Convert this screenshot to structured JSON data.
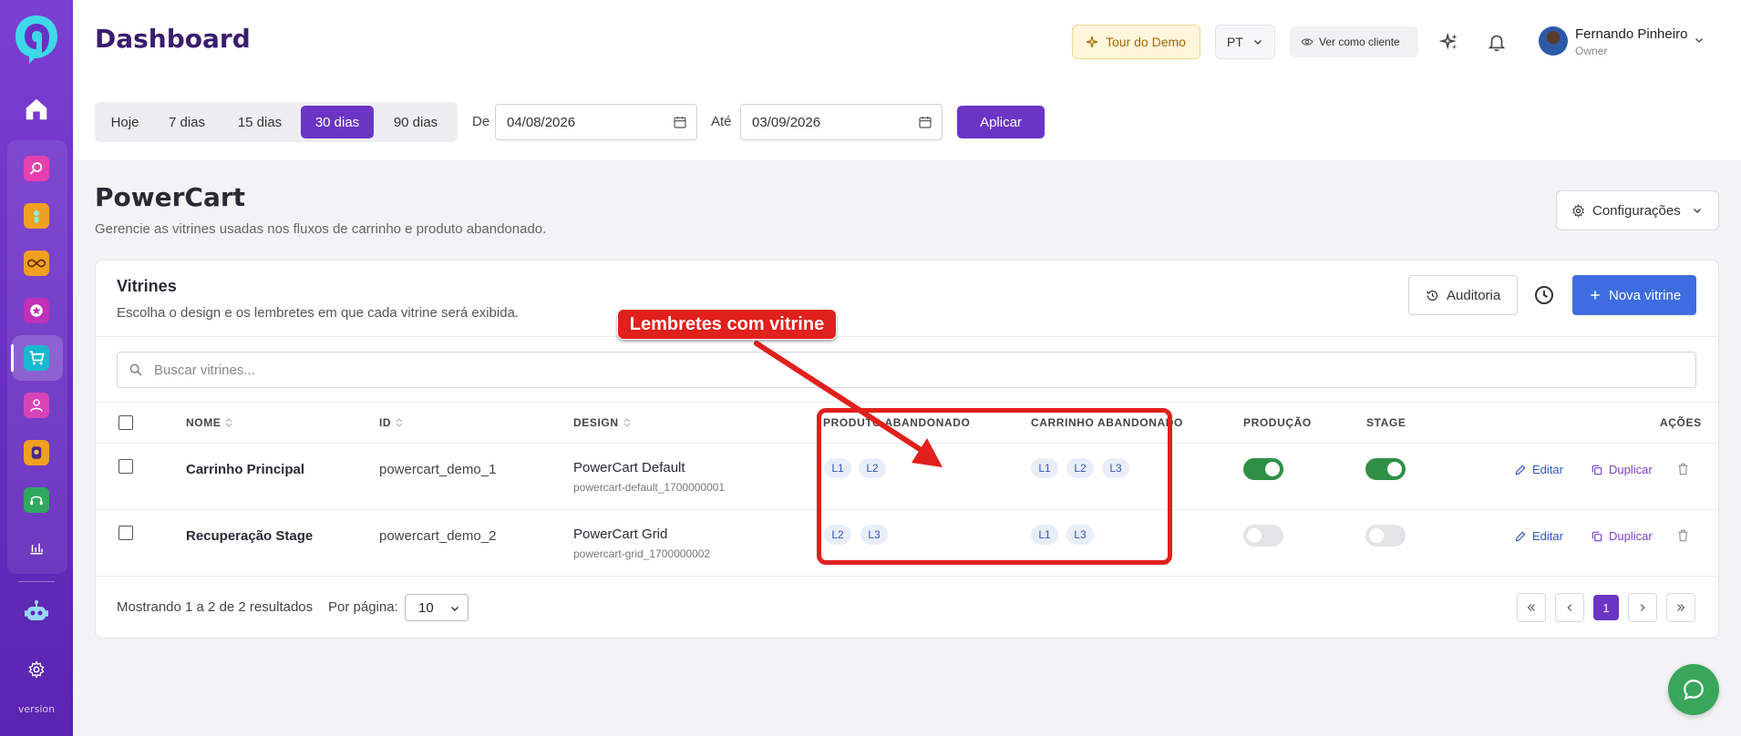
{
  "sidebar": {
    "version_label": "version",
    "items": [
      {
        "icon": "home-icon",
        "color": "#ffffff"
      },
      {
        "icon": "search-app-icon",
        "color": "#e63fb0"
      },
      {
        "icon": "user-app-icon",
        "color": "#f0a020"
      },
      {
        "icon": "infinity-app-icon",
        "color": "#f0a020"
      },
      {
        "icon": "star-app-icon",
        "color": "#c030b8"
      },
      {
        "icon": "cart-app-icon",
        "color": "#18b8d0",
        "active": true
      },
      {
        "icon": "person-app-icon",
        "color": "#d844b8"
      },
      {
        "icon": "badge-app-icon",
        "color": "#f0a020"
      },
      {
        "icon": "support-app-icon",
        "color": "#2fa860"
      },
      {
        "icon": "chart-icon",
        "color": "#ffffff"
      },
      {
        "icon": "robot-icon",
        "color": "#7ad0ff"
      },
      {
        "icon": "gear-icon",
        "color": "#ffffff"
      }
    ]
  },
  "header": {
    "title": "Dashboard",
    "tour_label": "Tour do Demo",
    "lang_label": "PT",
    "view_as_client_label": "Ver como cliente",
    "user_name": "Fernando Pinheiro",
    "user_role": "Owner"
  },
  "filters": {
    "ranges": [
      "Hoje",
      "7 dias",
      "15 dias",
      "30 dias",
      "90 dias"
    ],
    "active_range": "30 dias",
    "from_label": "De",
    "from_value": "04/08/2026",
    "to_label": "Até",
    "to_value": "03/09/2026",
    "apply_label": "Aplicar"
  },
  "section": {
    "title": "PowerCart",
    "subtitle": "Gerencie as vitrines usadas nos fluxos de carrinho e produto abandonado.",
    "config_label": "Configurações"
  },
  "card": {
    "title": "Vitrines",
    "subtitle": "Escolha o design e os lembretes em que cada vitrine será exibida.",
    "audit_label": "Auditoria",
    "new_label": "Nova vitrine",
    "search_placeholder": "Buscar vitrines...",
    "columns": {
      "name": "NOME",
      "id": "ID",
      "design": "DESIGN",
      "product": "PRODUTO ABANDONADO",
      "cart": "CARRINHO ABANDONADO",
      "production": "PRODUÇÃO",
      "stage": "STAGE",
      "actions": "AÇÕES"
    },
    "rows": [
      {
        "name": "Carrinho Principal",
        "id": "powercart_demo_1",
        "design": "PowerCart Default",
        "design_id": "powercart-default_1700000001",
        "product_reminders": [
          "L1",
          "L2"
        ],
        "cart_reminders": [
          "L1",
          "L2",
          "L3"
        ],
        "production": true,
        "stage": true,
        "edit_label": "Editar",
        "dup_label": "Duplicar"
      },
      {
        "name": "Recuperação Stage",
        "id": "powercart_demo_2",
        "design": "PowerCart Grid",
        "design_id": "powercart-grid_1700000002",
        "product_reminders": [
          "L2",
          "L3"
        ],
        "cart_reminders": [
          "L1",
          "L3"
        ],
        "production": false,
        "stage": false,
        "edit_label": "Editar",
        "dup_label": "Duplicar"
      }
    ],
    "footer_text": "Mostrando 1 a 2 de 2 resultados",
    "per_page_label": "Por página:",
    "per_page_value": "10",
    "current_page": "1"
  },
  "annotation": {
    "label": "Lembretes com vitrine",
    "color": "#e0201c"
  },
  "colors": {
    "brand_purple": "#6a35c5",
    "primary_blue": "#3d6de0",
    "toggle_green": "#2f8f45"
  }
}
